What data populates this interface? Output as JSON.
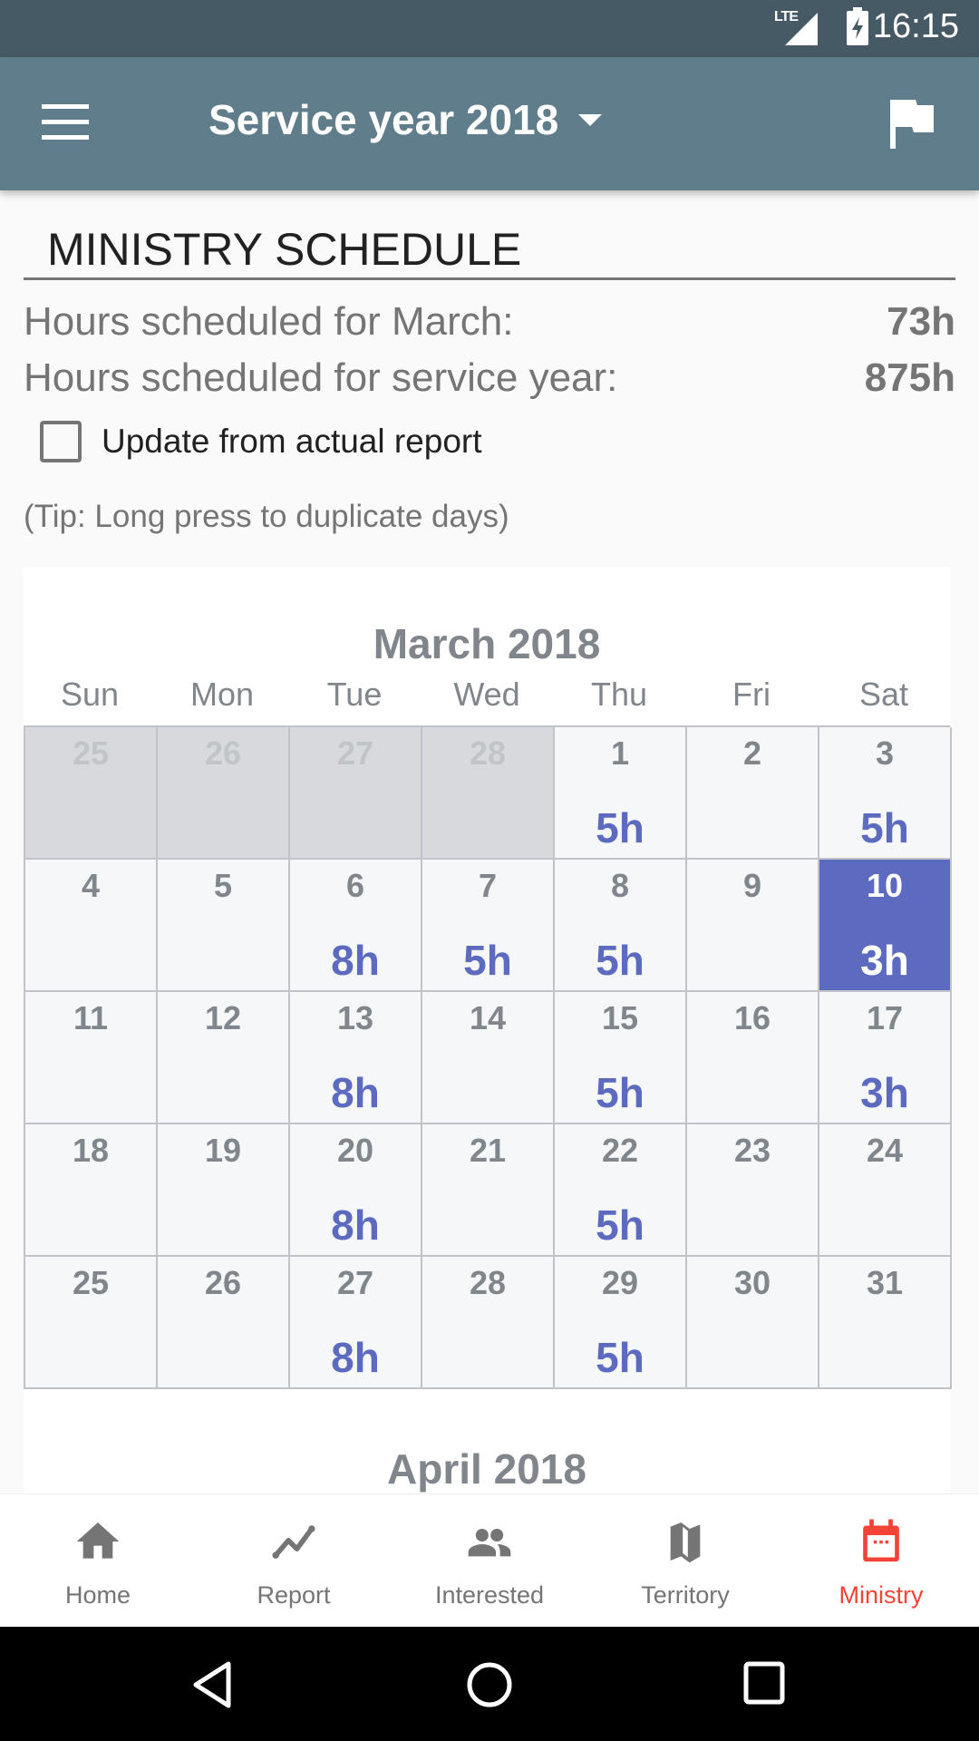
{
  "status_bar": {
    "network": "LTE",
    "time": "16:15"
  },
  "app_bar": {
    "menu_icon": "hamburger-menu-icon",
    "title": "Service year 2018",
    "dropdown_icon": "caret-down-icon",
    "action_icon": "flag-icon"
  },
  "schedule": {
    "heading": "MINISTRY SCHEDULE",
    "month_hours_label": "Hours scheduled for March:",
    "month_hours_value": "73h",
    "year_hours_label": "Hours scheduled for service year:",
    "year_hours_value": "875h",
    "update_checkbox_label": "Update from actual report",
    "update_checkbox_checked": false,
    "tip": "(Tip: Long press to duplicate days)"
  },
  "calendar": {
    "month_title": "March 2018",
    "next_month_title": "April 2018",
    "weekdays": [
      "Sun",
      "Mon",
      "Tue",
      "Wed",
      "Thu",
      "Fri",
      "Sat"
    ],
    "accent_color": "#5c6bc0",
    "days": [
      {
        "day": "25",
        "hours": "",
        "outside": true
      },
      {
        "day": "26",
        "hours": "",
        "outside": true
      },
      {
        "day": "27",
        "hours": "",
        "outside": true
      },
      {
        "day": "28",
        "hours": "",
        "outside": true
      },
      {
        "day": "1",
        "hours": "5h"
      },
      {
        "day": "2",
        "hours": ""
      },
      {
        "day": "3",
        "hours": "5h"
      },
      {
        "day": "4",
        "hours": ""
      },
      {
        "day": "5",
        "hours": ""
      },
      {
        "day": "6",
        "hours": "8h"
      },
      {
        "day": "7",
        "hours": "5h"
      },
      {
        "day": "8",
        "hours": "5h"
      },
      {
        "day": "9",
        "hours": ""
      },
      {
        "day": "10",
        "hours": "3h",
        "selected": true
      },
      {
        "day": "11",
        "hours": ""
      },
      {
        "day": "12",
        "hours": ""
      },
      {
        "day": "13",
        "hours": "8h"
      },
      {
        "day": "14",
        "hours": ""
      },
      {
        "day": "15",
        "hours": "5h"
      },
      {
        "day": "16",
        "hours": ""
      },
      {
        "day": "17",
        "hours": "3h"
      },
      {
        "day": "18",
        "hours": ""
      },
      {
        "day": "19",
        "hours": ""
      },
      {
        "day": "20",
        "hours": "8h"
      },
      {
        "day": "21",
        "hours": ""
      },
      {
        "day": "22",
        "hours": "5h"
      },
      {
        "day": "23",
        "hours": ""
      },
      {
        "day": "24",
        "hours": ""
      },
      {
        "day": "25",
        "hours": ""
      },
      {
        "day": "26",
        "hours": ""
      },
      {
        "day": "27",
        "hours": "8h"
      },
      {
        "day": "28",
        "hours": ""
      },
      {
        "day": "29",
        "hours": "5h"
      },
      {
        "day": "30",
        "hours": ""
      },
      {
        "day": "31",
        "hours": ""
      }
    ]
  },
  "bottom_nav": {
    "active_color": "#f44336",
    "items": [
      {
        "label": "Home",
        "icon": "home-icon",
        "active": false
      },
      {
        "label": "Report",
        "icon": "chart-line-icon",
        "active": false
      },
      {
        "label": "Interested",
        "icon": "people-icon",
        "active": false
      },
      {
        "label": "Territory",
        "icon": "map-icon",
        "active": false
      },
      {
        "label": "Ministry",
        "icon": "calendar-icon",
        "active": true
      }
    ]
  },
  "system_nav": {
    "back_icon": "back-triangle-icon",
    "home_icon": "home-circle-icon",
    "recents_icon": "recents-square-icon"
  }
}
